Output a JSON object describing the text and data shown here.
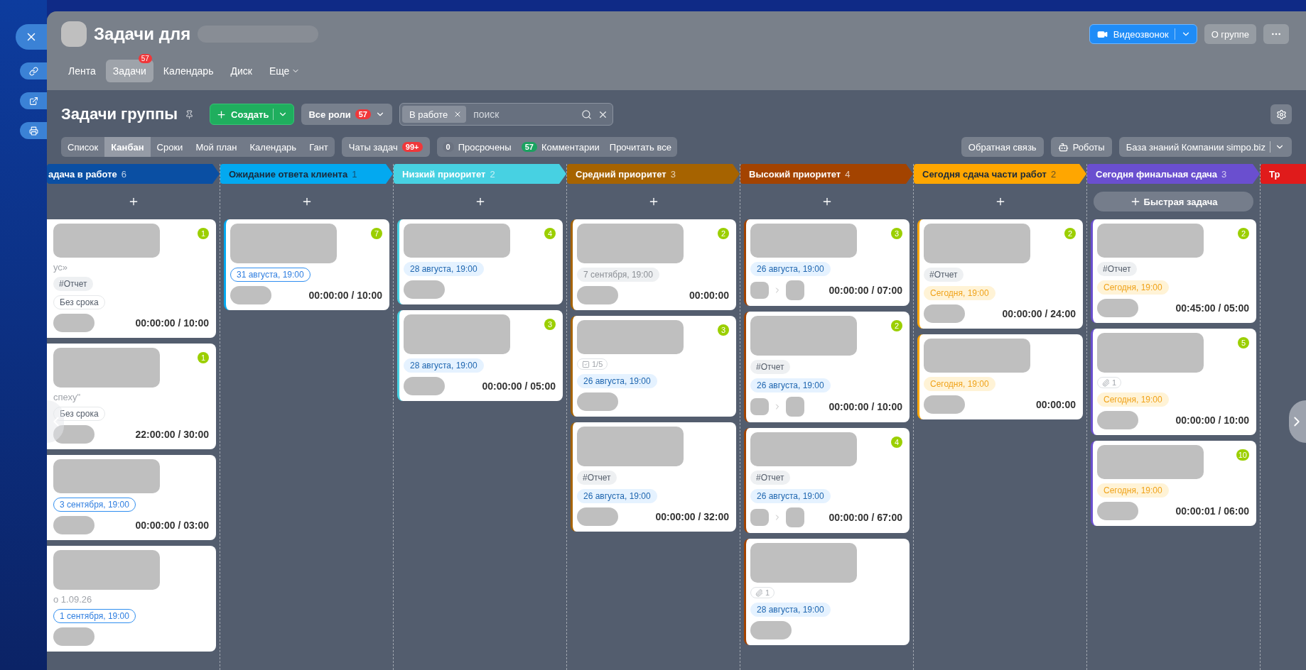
{
  "header": {
    "title": "Задачи для",
    "video_call": "Видеозвонок",
    "about": "О группе"
  },
  "tabs": [
    {
      "label": "Лента",
      "selected": false
    },
    {
      "label": "Задачи",
      "selected": true,
      "badge": "57"
    },
    {
      "label": "Календарь",
      "selected": false
    },
    {
      "label": "Диск",
      "selected": false
    },
    {
      "label": "Еще",
      "selected": false,
      "menu": true
    }
  ],
  "toolbar": {
    "title": "Задачи группы",
    "create": "Создать",
    "roles": "Все роли",
    "roles_badge": "57",
    "filter_chip": "В работе",
    "search_placeholder": "поиск"
  },
  "views": [
    {
      "label": "Список",
      "selected": false
    },
    {
      "label": "Канбан",
      "selected": true
    },
    {
      "label": "Сроки",
      "selected": false
    },
    {
      "label": "Мой план",
      "selected": false
    },
    {
      "label": "Календарь",
      "selected": false
    },
    {
      "label": "Гант",
      "selected": false
    }
  ],
  "chats": {
    "label": "Чаты задач",
    "badge": "99+"
  },
  "counters": [
    {
      "count": "0",
      "label": "Просрочены",
      "color": "#6b7280"
    },
    {
      "count": "57",
      "label": "Комментарии",
      "color": "#1aa260"
    }
  ],
  "read_all": "Прочитать все",
  "right_buttons": [
    {
      "label": "Обратная связь",
      "kind": "plain"
    },
    {
      "label": "Роботы",
      "kind": "robot"
    },
    {
      "label": "База знаний Компании simpo.biz",
      "kind": "menu"
    }
  ],
  "columns": [
    {
      "title": "адача в работе",
      "count": "6",
      "color": "#0a4fa3",
      "cards": [
        {
          "badge": "1",
          "note": "ус»",
          "tag": "#Отчет",
          "deadline": {
            "text": "Без срока",
            "kind": "plain"
          },
          "time": "00:00:00 / 10:00"
        },
        {
          "badge": "1",
          "note": "спеху\"",
          "deadline": {
            "text": "Без срока",
            "kind": "plain"
          },
          "time": "22:00:00 / 30:00"
        },
        {
          "deadline": {
            "text": "3 сентября, 19:00",
            "kind": "outline"
          },
          "time": "00:00:00 / 03:00"
        },
        {
          "note": "о 1.09.26",
          "deadline": {
            "text": "1 сентября, 19:00",
            "kind": "outline"
          }
        }
      ]
    },
    {
      "title": "Ожидание ответа клиента",
      "count": "1",
      "color": "#03a9f0",
      "dark_text": true,
      "cards": [
        {
          "badge": "7",
          "deadline": {
            "text": "31 августа, 19:00",
            "kind": "outline"
          },
          "time": "00:00:00 / 10:00"
        }
      ]
    },
    {
      "title": "Низкий приоритет",
      "count": "2",
      "color": "#47d1e2",
      "cards": [
        {
          "badge": "4",
          "deadline": {
            "text": "28 августа, 19:00",
            "kind": "blue"
          }
        },
        {
          "badge": "3",
          "deadline": {
            "text": "28 августа, 19:00",
            "kind": "blue"
          },
          "time": "00:00:00 / 05:00"
        }
      ]
    },
    {
      "title": "Средний приоритет",
      "count": "3",
      "color": "#a66300",
      "cards": [
        {
          "badge": "2",
          "deadline": {
            "text": "7 сентября, 19:00",
            "kind": "gray"
          },
          "time": "00:00:00"
        },
        {
          "badge": "3",
          "checklist": "1/5",
          "deadline": {
            "text": "26 августа, 19:00",
            "kind": "blue"
          }
        },
        {
          "tag": "#Отчет",
          "deadline": {
            "text": "26 августа, 19:00",
            "kind": "blue"
          },
          "time": "00:00:00 / 32:00"
        }
      ]
    },
    {
      "title": "Высокий приоритет",
      "count": "4",
      "color": "#a34300",
      "cards": [
        {
          "badge": "3",
          "deadline": {
            "text": "26 августа, 19:00",
            "kind": "blue"
          },
          "delegated": true,
          "time": "00:00:00 / 07:00"
        },
        {
          "badge": "2",
          "tag": "#Отчет",
          "deadline": {
            "text": "26 августа, 19:00",
            "kind": "blue"
          },
          "delegated": true,
          "time": "00:00:00 / 10:00"
        },
        {
          "badge": "4",
          "tag": "#Отчет",
          "deadline": {
            "text": "26 августа, 19:00",
            "kind": "blue"
          },
          "delegated": true,
          "time": "00:00:00 / 67:00"
        },
        {
          "attachments": "1",
          "deadline": {
            "text": "28 августа, 19:00",
            "kind": "blue"
          }
        }
      ]
    },
    {
      "title": "Сегодня сдача части работ",
      "count": "2",
      "color": "#ffa600",
      "dark_text": true,
      "cards": [
        {
          "badge": "2",
          "tag": "#Отчет",
          "deadline": {
            "text": "Сегодня, 19:00",
            "kind": "today"
          },
          "time": "00:00:00 / 24:00"
        },
        {
          "deadline": {
            "text": "Сегодня, 19:00",
            "kind": "today"
          },
          "time": "00:00:00"
        }
      ]
    },
    {
      "title": "Сегодня финальная сдача",
      "count": "3",
      "color": "#6a4fcf",
      "quick_add": "Быстрая задача",
      "cards": [
        {
          "badge": "2",
          "tag": "#Отчет",
          "deadline": {
            "text": "Сегодня, 19:00",
            "kind": "today"
          },
          "time": "00:45:00 / 05:00"
        },
        {
          "badge": "5",
          "attachments": "1",
          "deadline": {
            "text": "Сегодня, 19:00",
            "kind": "today"
          },
          "time": "00:00:00 / 10:00"
        },
        {
          "badge": "10",
          "deadline": {
            "text": "Сегодня, 19:00",
            "kind": "today"
          },
          "time": "00:00:01 / 06:00"
        }
      ]
    },
    {
      "title": "Тр",
      "color": "#e01b1b"
    }
  ]
}
